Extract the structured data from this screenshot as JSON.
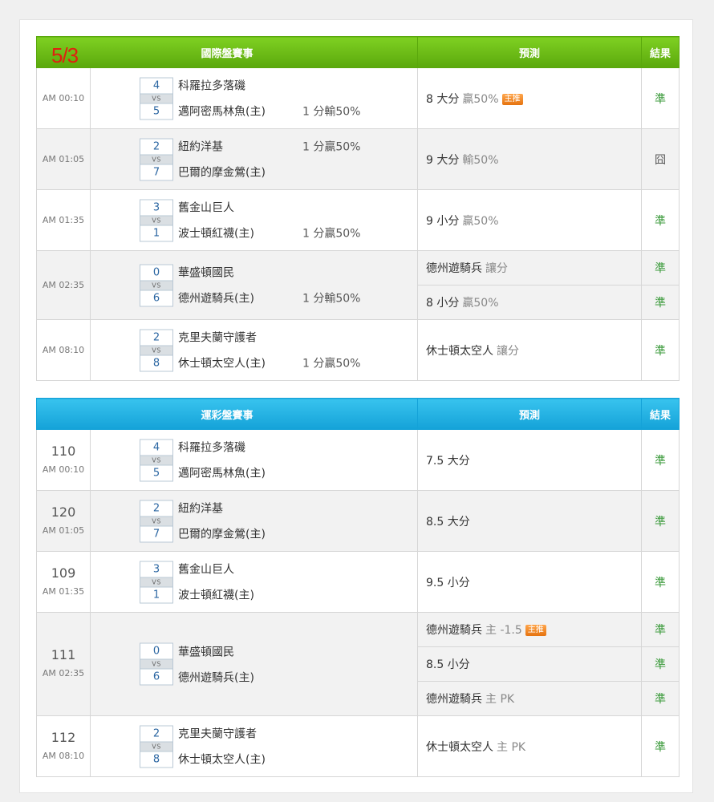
{
  "date_tag": "5/3",
  "intl": {
    "header": {
      "section": "國際盤賽事",
      "prediction": "預測",
      "result": "結果"
    },
    "games": [
      {
        "time": "AM 00:10",
        "away_score": "4",
        "away": "科羅拉多落磯",
        "home_score": "5",
        "home": "邁阿密馬林魚(主)",
        "hcap": "1 分輸50%",
        "hcap_row": "home",
        "preds": [
          {
            "main": "8 大分",
            "sub": "贏50%",
            "badge": "主推",
            "result": "準"
          }
        ]
      },
      {
        "time": "AM 01:05",
        "away_score": "2",
        "away": "紐約洋基",
        "home_score": "7",
        "home": "巴爾的摩金鶯(主)",
        "hcap": "1 分贏50%",
        "hcap_row": "away",
        "preds": [
          {
            "main": "9 大分",
            "sub": "輸50%",
            "badge": "",
            "result": "囧"
          }
        ]
      },
      {
        "time": "AM 01:35",
        "away_score": "3",
        "away": "舊金山巨人",
        "home_score": "1",
        "home": "波士頓紅襪(主)",
        "hcap": "1 分贏50%",
        "hcap_row": "home",
        "preds": [
          {
            "main": "9 小分",
            "sub": "贏50%",
            "badge": "",
            "result": "準"
          }
        ]
      },
      {
        "time": "AM 02:35",
        "away_score": "0",
        "away": "華盛頓國民",
        "home_score": "6",
        "home": "德州遊騎兵(主)",
        "hcap": "1 分輸50%",
        "hcap_row": "home",
        "preds": [
          {
            "main": "德州遊騎兵",
            "sub": "讓分",
            "badge": "",
            "result": "準"
          },
          {
            "main": "8 小分",
            "sub": "贏50%",
            "badge": "",
            "result": "準"
          }
        ]
      },
      {
        "time": "AM 08:10",
        "away_score": "2",
        "away": "克里夫蘭守護者",
        "home_score": "8",
        "home": "休士頓太空人(主)",
        "hcap": "1 分贏50%",
        "hcap_row": "home",
        "preds": [
          {
            "main": "休士頓太空人",
            "sub": "讓分",
            "badge": "",
            "result": "準"
          }
        ]
      }
    ]
  },
  "lottery": {
    "header": {
      "section": "運彩盤賽事",
      "prediction": "預測",
      "result": "結果"
    },
    "games": [
      {
        "code": "110",
        "time": "AM 00:10",
        "away_score": "4",
        "away": "科羅拉多落磯",
        "home_score": "5",
        "home": "邁阿密馬林魚(主)",
        "preds": [
          {
            "main": "7.5 大分",
            "sub": "",
            "badge": "",
            "result": "準"
          }
        ]
      },
      {
        "code": "120",
        "time": "AM 01:05",
        "away_score": "2",
        "away": "紐約洋基",
        "home_score": "7",
        "home": "巴爾的摩金鶯(主)",
        "preds": [
          {
            "main": "8.5 大分",
            "sub": "",
            "badge": "",
            "result": "準"
          }
        ]
      },
      {
        "code": "109",
        "time": "AM 01:35",
        "away_score": "3",
        "away": "舊金山巨人",
        "home_score": "1",
        "home": "波士頓紅襪(主)",
        "preds": [
          {
            "main": "9.5 小分",
            "sub": "",
            "badge": "",
            "result": "準"
          }
        ]
      },
      {
        "code": "111",
        "time": "AM 02:35",
        "away_score": "0",
        "away": "華盛頓國民",
        "home_score": "6",
        "home": "德州遊騎兵(主)",
        "preds": [
          {
            "main": "德州遊騎兵",
            "sub": "主 -1.5",
            "badge": "主推",
            "result": "準"
          },
          {
            "main": "8.5 小分",
            "sub": "",
            "badge": "",
            "result": "準"
          },
          {
            "main": "德州遊騎兵",
            "sub": "主 PK",
            "badge": "",
            "result": "準"
          }
        ]
      },
      {
        "code": "112",
        "time": "AM 08:10",
        "away_score": "2",
        "away": "克里夫蘭守護者",
        "home_score": "8",
        "home": "休士頓太空人(主)",
        "preds": [
          {
            "main": "休士頓太空人",
            "sub": "主 PK",
            "badge": "",
            "result": "準"
          }
        ]
      }
    ]
  },
  "vs_label": "VS",
  "colors": {
    "intl_header": "#6cbf17",
    "lottery_header": "#1fb0e3",
    "result_ok": "#3a9a3a",
    "badge": "#f08a26",
    "score_text": "#2b66a2"
  }
}
